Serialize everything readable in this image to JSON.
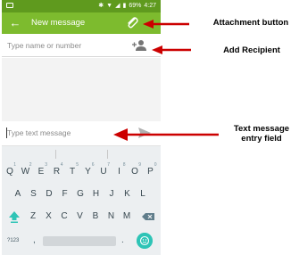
{
  "status_bar": {
    "battery": "69%",
    "time": "4:27"
  },
  "app_bar": {
    "title": "New message"
  },
  "recipient": {
    "placeholder": "Type name or number"
  },
  "compose": {
    "placeholder": "Type text message"
  },
  "keyboard": {
    "row1": [
      {
        "k": "Q",
        "n": "1"
      },
      {
        "k": "W",
        "n": "2"
      },
      {
        "k": "E",
        "n": "3"
      },
      {
        "k": "R",
        "n": "4"
      },
      {
        "k": "T",
        "n": "5"
      },
      {
        "k": "Y",
        "n": "6"
      },
      {
        "k": "U",
        "n": "7"
      },
      {
        "k": "I",
        "n": "8"
      },
      {
        "k": "O",
        "n": "9"
      },
      {
        "k": "P",
        "n": "0"
      }
    ],
    "row2": [
      "A",
      "S",
      "D",
      "F",
      "G",
      "H",
      "J",
      "K",
      "L"
    ],
    "row3": [
      "Z",
      "X",
      "C",
      "V",
      "B",
      "N",
      "M"
    ],
    "symbols_label": "?123",
    "comma": ",",
    "period": "."
  },
  "annotations": {
    "attachment": "Attachment button",
    "add_recipient": "Add Recipient",
    "text_entry_line1": "Text message",
    "text_entry_line2": "entry field"
  },
  "colors": {
    "status_bar": "#5f9a1e",
    "app_bar": "#7dbb2e",
    "arrow": "#cc0000",
    "emoji": "#2ec4b6"
  }
}
